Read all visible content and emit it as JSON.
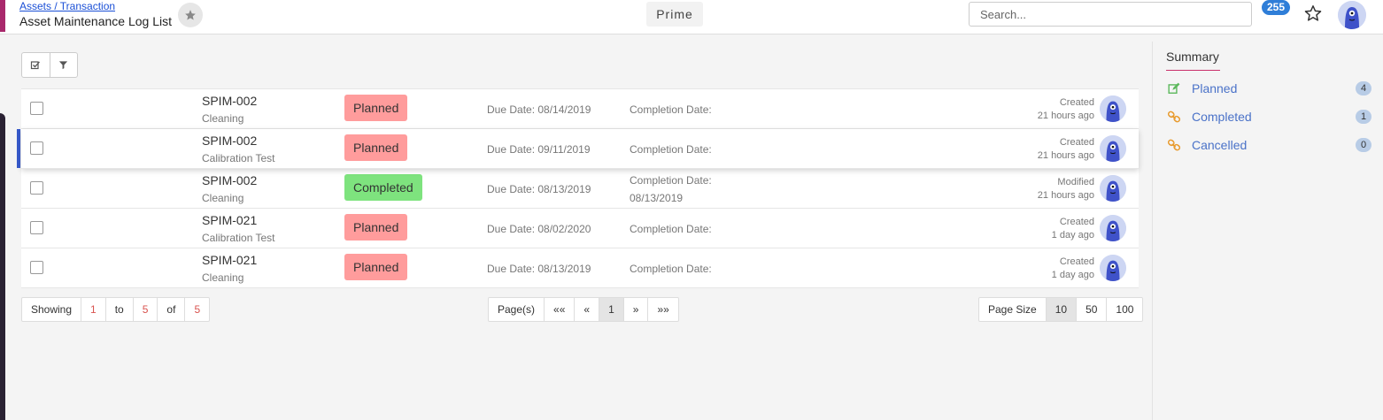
{
  "header": {
    "breadcrumb": "Assets / Transaction",
    "title": "Asset Maintenance Log List",
    "prime_label": "Prime",
    "search_placeholder": "Search...",
    "notification_count": "255"
  },
  "toolbar": {
    "select_icon": "check-square-icon",
    "filter_icon": "filter-icon"
  },
  "rows": [
    {
      "code": "SPIM-002",
      "type": "Cleaning",
      "status": "Planned",
      "status_color": "#ff9c9c",
      "due": "Due Date: 08/14/2019",
      "completion_label": "Completion Date:",
      "completion_date": "",
      "audit_action": "Created",
      "audit_time": "21 hours ago"
    },
    {
      "code": "SPIM-002",
      "type": "Calibration Test",
      "status": "Planned",
      "status_color": "#ff9c9c",
      "due": "Due Date: 09/11/2019",
      "completion_label": "Completion Date:",
      "completion_date": "",
      "audit_action": "Created",
      "audit_time": "21 hours ago"
    },
    {
      "code": "SPIM-002",
      "type": "Cleaning",
      "status": "Completed",
      "status_color": "#7ee37e",
      "due": "Due Date: 08/13/2019",
      "completion_label": "Completion Date:",
      "completion_date": "08/13/2019",
      "audit_action": "Modified",
      "audit_time": "21 hours ago"
    },
    {
      "code": "SPIM-021",
      "type": "Calibration Test",
      "status": "Planned",
      "status_color": "#ff9c9c",
      "due": "Due Date: 08/02/2020",
      "completion_label": "Completion Date:",
      "completion_date": "",
      "audit_action": "Created",
      "audit_time": "1 day ago"
    },
    {
      "code": "SPIM-021",
      "type": "Cleaning",
      "status": "Planned",
      "status_color": "#ff9c9c",
      "due": "Due Date: 08/13/2019",
      "completion_label": "Completion Date:",
      "completion_date": "",
      "audit_action": "Created",
      "audit_time": "1 day ago"
    }
  ],
  "pagination": {
    "showing_label": "Showing",
    "from": "1",
    "to_label": "to",
    "to": "5",
    "of_label": "of",
    "total": "5",
    "pages_label": "Page(s)",
    "first": "««",
    "prev": "«",
    "current_page": "1",
    "next": "»",
    "last": "»»",
    "page_size_label": "Page Size",
    "page_sizes": [
      "10",
      "50",
      "100"
    ],
    "selected_page_size": "10"
  },
  "summary": {
    "title": "Summary",
    "items": [
      {
        "label": "Planned",
        "count": "4",
        "icon": "edit-icon",
        "icon_color": "#5cb85c"
      },
      {
        "label": "Completed",
        "count": "1",
        "icon": "link-icon",
        "icon_color": "#e89a2c"
      },
      {
        "label": "Cancelled",
        "count": "0",
        "icon": "link-icon",
        "icon_color": "#e89a2c"
      }
    ]
  },
  "colors": {
    "accent": "#3557c7",
    "planned": "#ff9c9c",
    "completed": "#7ee37e",
    "link": "#4a72c8"
  }
}
